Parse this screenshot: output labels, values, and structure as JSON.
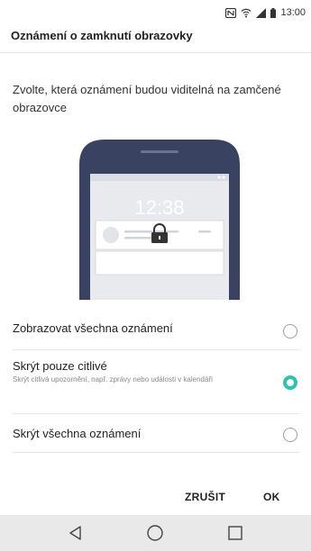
{
  "status_bar": {
    "time": "13:00",
    "icons": [
      "nfc-icon",
      "wifi-icon",
      "signal-icon",
      "battery-icon"
    ]
  },
  "dialog": {
    "title": "Oznámení o zamknutí obrazovky",
    "description": "Zvolte, která oznámení budou viditelná na zamčené obrazovce",
    "illustration": {
      "clock": "12:38",
      "lock_icon": "lock-icon"
    },
    "options": [
      {
        "label": "Zobrazovat všechna oznámení",
        "sublabel": "",
        "selected": false
      },
      {
        "label": "Skrýt pouze citlivé",
        "sublabel": "Skrýt citlivá upozornění, např. zprávy nebo události v kalendáři",
        "selected": true
      },
      {
        "label": "Skrýt všechna oznámení",
        "sublabel": "",
        "selected": false
      }
    ],
    "cancel_label": "ZRUŠIT",
    "ok_label": "OK"
  },
  "nav_bar": {
    "icons": [
      "back-icon",
      "home-icon",
      "recents-icon"
    ]
  },
  "colors": {
    "accent": "#26c6b0",
    "phone_body": "#3a4262",
    "nav_bg": "#e9e9e9"
  }
}
